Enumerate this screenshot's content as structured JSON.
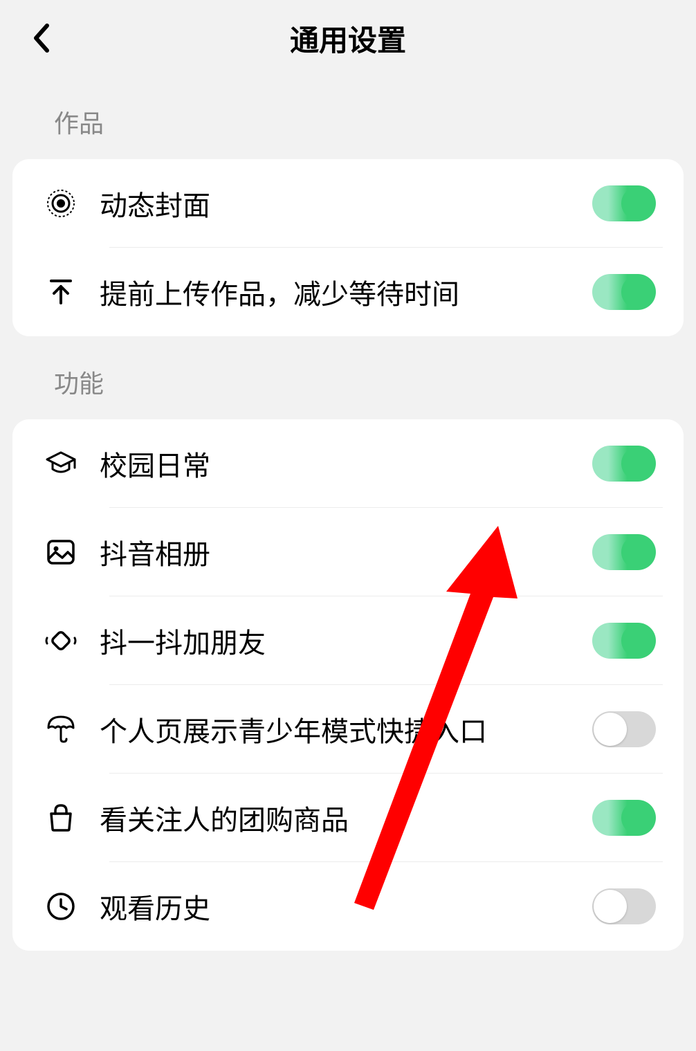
{
  "header": {
    "title": "通用设置"
  },
  "sections": [
    {
      "label": "作品",
      "items": [
        {
          "icon": "target-icon",
          "label": "动态封面",
          "on": true
        },
        {
          "icon": "upload-icon",
          "label": "提前上传作品，减少等待时间",
          "on": true
        }
      ]
    },
    {
      "label": "功能",
      "items": [
        {
          "icon": "graduation-cap-icon",
          "label": "校园日常",
          "on": true
        },
        {
          "icon": "photo-icon",
          "label": "抖音相册",
          "on": true
        },
        {
          "icon": "shake-icon",
          "label": "抖一抖加朋友",
          "on": true
        },
        {
          "icon": "umbrella-icon",
          "label": "个人页展示青少年模式快捷入口",
          "on": false
        },
        {
          "icon": "bag-icon",
          "label": "看关注人的团购商品",
          "on": true
        },
        {
          "icon": "clock-icon",
          "label": "观看历史",
          "on": false
        }
      ]
    }
  ]
}
